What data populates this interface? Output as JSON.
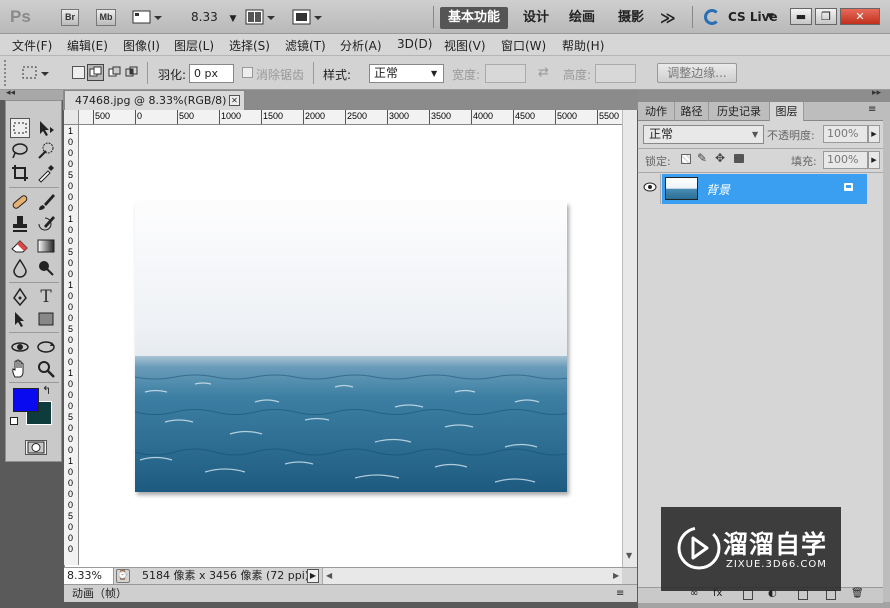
{
  "titlebar": {
    "app_logo": "Ps",
    "bridge": "Br",
    "minibridge": "Mb",
    "zoom": "8.33",
    "workspaces": [
      "基本功能",
      "设计",
      "绘画",
      "摄影"
    ],
    "more": "≫",
    "cslive": "CS Live",
    "win_buttons": [
      "▬",
      "❐",
      "✕"
    ]
  },
  "menu": [
    "文件(F)",
    "编辑(E)",
    "图像(I)",
    "图层(L)",
    "选择(S)",
    "滤镜(T)",
    "分析(A)",
    "3D(D)",
    "视图(V)",
    "窗口(W)",
    "帮助(H)"
  ],
  "options": {
    "feather_label": "羽化:",
    "feather_value": "0 px",
    "antialias_label": "消除锯齿",
    "style_label": "样式:",
    "style_value": "正常",
    "width_label": "宽度:",
    "height_label": "高度:",
    "refine_button": "调整边缘..."
  },
  "document": {
    "tab_title": "47468.jpg @ 8.33%(RGB/8)",
    "close": "✕",
    "ruler_top": [
      "500",
      "0",
      "500",
      "1000",
      "1500",
      "2000",
      "2500",
      "3000",
      "3500",
      "4000",
      "4500",
      "5000",
      "5500"
    ],
    "ruler_left": [
      "1",
      "0",
      "0",
      "0",
      "5",
      "0",
      "0",
      "0",
      "1",
      "0",
      "0",
      "5",
      "0",
      "0",
      "1",
      "0",
      "0",
      "0",
      "5",
      "0",
      "0",
      "0",
      "1",
      "0",
      "0",
      "0",
      "5",
      "0",
      "0",
      "0",
      "1",
      "0",
      "0",
      "0",
      "0",
      "5",
      "0",
      "0",
      "0"
    ],
    "zoom": "8.33%",
    "info": "5184 像素 x 3456 像素 (72 ppi)",
    "anim_tab": "动画（帧）"
  },
  "panel": {
    "tabs": [
      "动作",
      "路径",
      "历史记录",
      "图层"
    ],
    "blend_mode": "正常",
    "opacity_label": "不透明度:",
    "opacity_value": "100%",
    "lock_label": "锁定:",
    "fill_label": "填充:",
    "fill_value": "100%",
    "layer_name": "背景"
  },
  "watermark": {
    "title": "溜溜自学",
    "url": "ZIXUE.3D66.COM"
  },
  "colors": {
    "foreground": "#0a0af0",
    "background": "#0e3c3c",
    "layer_selected": "#3a9ff0"
  }
}
